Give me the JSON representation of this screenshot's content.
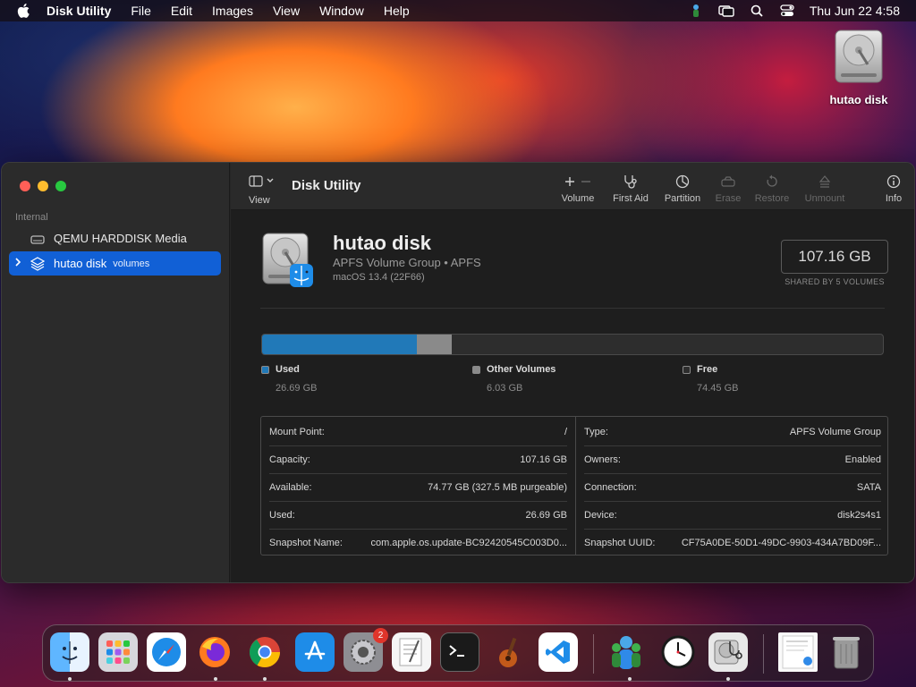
{
  "menubar": {
    "app_name": "Disk Utility",
    "items": [
      "File",
      "Edit",
      "Images",
      "View",
      "Window",
      "Help"
    ],
    "clock": "Thu Jun 22  4:58"
  },
  "desktop": {
    "icon_label": "hutao disk"
  },
  "window": {
    "title": "Disk Utility",
    "sidebar": {
      "section": "Internal",
      "items": [
        {
          "label": "QEMU HARDDISK Media",
          "sub": ""
        },
        {
          "label": "hutao disk",
          "sub": "volumes"
        }
      ]
    },
    "toolbar": {
      "view_label": "View",
      "buttons": [
        {
          "label": "Volume",
          "icon": "plus-minus-icon",
          "enabled": true
        },
        {
          "label": "First Aid",
          "icon": "stethoscope-icon",
          "enabled": true
        },
        {
          "label": "Partition",
          "icon": "pie-icon",
          "enabled": true
        },
        {
          "label": "Erase",
          "icon": "eraser-icon",
          "enabled": false
        },
        {
          "label": "Restore",
          "icon": "restore-icon",
          "enabled": false
        },
        {
          "label": "Unmount",
          "icon": "eject-icon",
          "enabled": false
        },
        {
          "label": "Info",
          "icon": "info-icon",
          "enabled": true
        }
      ]
    },
    "disk": {
      "name": "hutao disk",
      "subtitle": "APFS Volume Group • APFS",
      "os": "macOS 13.4 (22F66)",
      "size": "107.16 GB",
      "size_caption": "SHARED BY 5 VOLUMES"
    },
    "usage": {
      "total_gb": 107.16,
      "segments": [
        {
          "label": "Used",
          "value": "26.69 GB",
          "gb": 26.69,
          "color": "#2179b8"
        },
        {
          "label": "Other Volumes",
          "value": "6.03 GB",
          "gb": 6.03,
          "color": "#8a8a8a"
        },
        {
          "label": "Free",
          "value": "74.45 GB",
          "gb": 74.45,
          "color": "#2d2d2d"
        }
      ]
    },
    "info_left": [
      {
        "key": "Mount Point:",
        "value": "/"
      },
      {
        "key": "Capacity:",
        "value": "107.16 GB"
      },
      {
        "key": "Available:",
        "value": "74.77 GB (327.5 MB purgeable)"
      },
      {
        "key": "Used:",
        "value": "26.69 GB"
      },
      {
        "key": "Snapshot Name:",
        "value": "com.apple.os.update-BC92420545C003D0..."
      }
    ],
    "info_right": [
      {
        "key": "Type:",
        "value": "APFS Volume Group"
      },
      {
        "key": "Owners:",
        "value": "Enabled"
      },
      {
        "key": "Connection:",
        "value": "SATA"
      },
      {
        "key": "Device:",
        "value": "disk2s4s1"
      },
      {
        "key": "Snapshot UUID:",
        "value": "CF75A0DE-50D1-49DC-9903-434A7BD09F..."
      }
    ]
  },
  "dock": {
    "system_settings_badge": "2",
    "apps": [
      "finder-icon",
      "launchpad-icon",
      "safari-icon",
      "firefox-icon",
      "chrome-icon",
      "app-store-icon",
      "system-settings-icon",
      "textedit-icon",
      "terminal-icon",
      "instruments-icon",
      "vscode-icon",
      "directory-utility-icon",
      "clock-icon",
      "disk-utility-icon",
      "document-icon",
      "trash-icon"
    ]
  }
}
